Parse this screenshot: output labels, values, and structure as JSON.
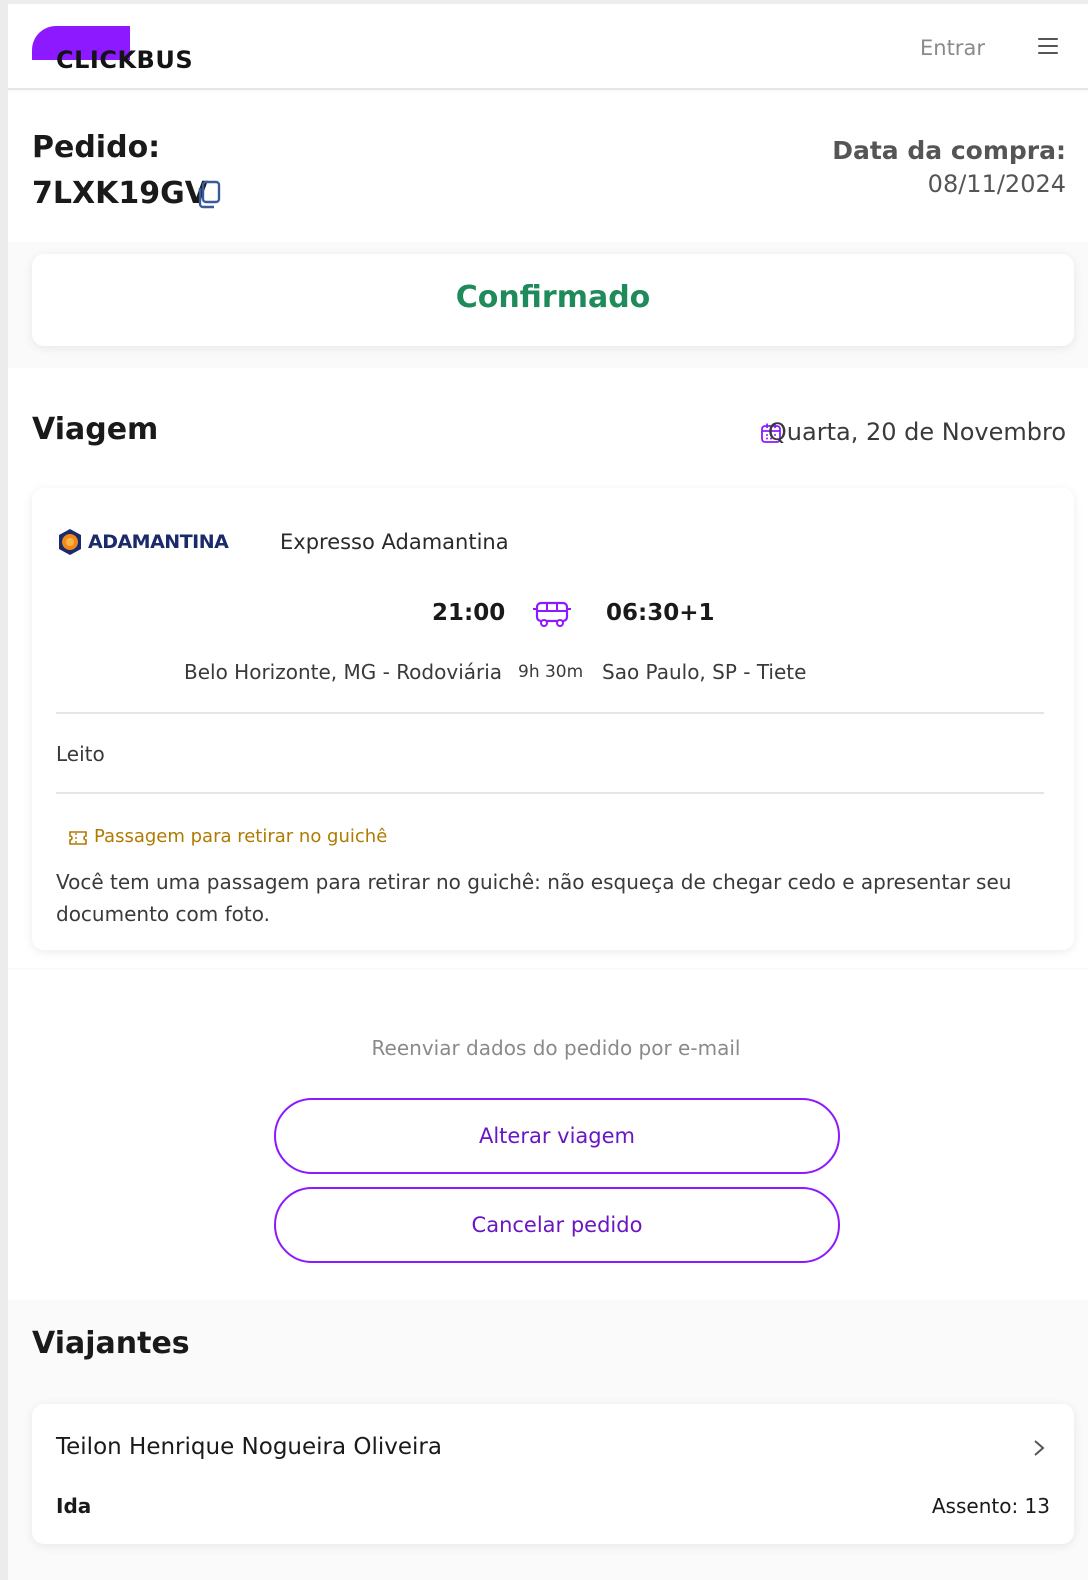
{
  "header": {
    "logo_text": "CLICKBUS",
    "login_label": "Entrar",
    "brand_color": "#8c19ff"
  },
  "order": {
    "label": "Pedido:",
    "code": "7LXK19GV",
    "purchase_label": "Data da compra:",
    "purchase_date": "08/11/2024"
  },
  "status": {
    "text": "Confirmado",
    "color": "#1f8a5a"
  },
  "trip": {
    "title": "Viagem",
    "date": "Quarta, 20 de Novembro",
    "company_logo_text": "ADAMANTINA",
    "company_name": "Expresso Adamantina",
    "departure_time": "21:00",
    "arrival_time": "06:30+1",
    "origin": "Belo Horizonte, MG - Rodoviária",
    "duration": "9h 30m",
    "destination": "Sao Paulo, SP - Tiete",
    "seat_class": "Leito",
    "pickup_tag": "Passagem para retirar no guichê",
    "pickup_description": "Você tem uma passagem para retirar no guichê: não esqueça de chegar cedo e apresentar seu documento com foto."
  },
  "actions": {
    "resend_label": "Reenviar dados do pedido por e-mail",
    "change_trip_label": "Alterar viagem",
    "cancel_order_label": "Cancelar pedido"
  },
  "travelers": {
    "title": "Viajantes",
    "items": [
      {
        "name": "Teilon Henrique Nogueira Oliveira",
        "leg": "Ida",
        "seat": "Assento: 13"
      }
    ]
  },
  "icons": {
    "menu": "hamburger-menu-icon",
    "copy": "copy-icon",
    "calendar": "calendar-icon",
    "bus": "bus-icon",
    "ticket": "ticket-icon",
    "chevron": "chevron-right-icon"
  }
}
